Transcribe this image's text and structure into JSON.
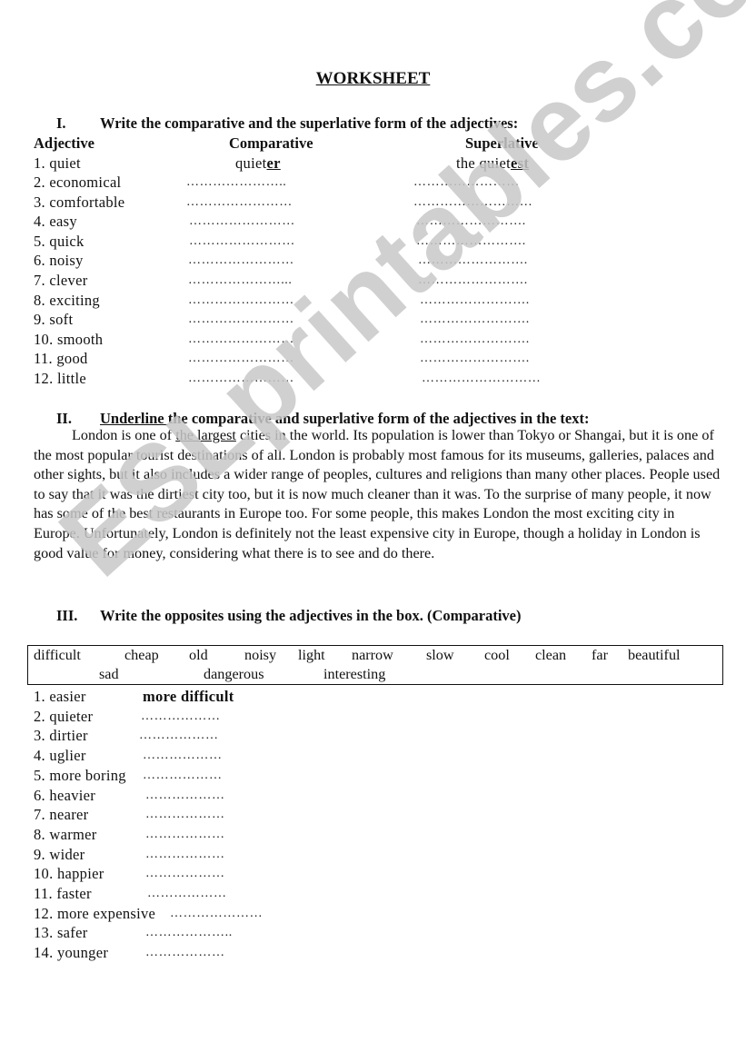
{
  "title": "WORKSHEET",
  "watermark": "ESLprintables.com",
  "section1": {
    "numeral": "I.",
    "instruction": "Write the comparative and the superlative form of the adjectives:",
    "headers": {
      "adjective": "Adjective",
      "comparative": "Comparative",
      "superlative": "Superlative"
    },
    "example": {
      "adjective": "1. quiet",
      "comparative_stem": "quiet",
      "comparative_suffix": "er",
      "superlative_stem": "the quiet",
      "superlative_suffix": "est"
    },
    "rows": [
      {
        "adjective": "2. economical",
        "comparative": "…………………..",
        "superlative": "……………………"
      },
      {
        "adjective": "3. comfortable",
        "comparative": "……………………",
        "superlative": "………………………"
      },
      {
        "adjective": "4. easy",
        "comparative": "……………………",
        "superlative": "……………………."
      },
      {
        "adjective": "5. quick",
        "comparative": "……………………",
        "superlative": "……………………."
      },
      {
        "adjective": "6. noisy",
        "comparative": "……………………",
        "superlative": "……………………."
      },
      {
        "adjective": "7. clever",
        "comparative": "…………………...",
        "superlative": "……………………."
      },
      {
        "adjective": "8. exciting",
        "comparative": "……………………",
        "superlative": "……………………."
      },
      {
        "adjective": "9. soft",
        "comparative": "……………………",
        "superlative": "……………………."
      },
      {
        "adjective": "10.  smooth",
        "comparative": "……………………",
        "superlative": "……………………."
      },
      {
        "adjective": "11.  good",
        "comparative": "……………………",
        "superlative": "……………………."
      },
      {
        "adjective": "12.  little",
        "comparative": "……………………",
        "superlative": "………………………"
      }
    ]
  },
  "section2": {
    "numeral": "II.",
    "instruction_underlined": "Underline ",
    "instruction_rest": "the comparative and superlative form of the adjectives in the text:",
    "text_before": "London is one of ",
    "text_example": "the largest",
    "text_after": " cities in the world. Its population is lower than Tokyo or Shangai, but it is one of the most popular tourist destinations of all. London is probably most famous for its museums, galleries, palaces and other sights, but it also includes a wider range of peoples, cultures and religions than many other places. People used to say that it was the dirtiest city too, but it is now much cleaner than it was. To the surprise of many people, it now has some of the best restaurants in Europe too. For some people, this makes London the most exciting city in Europe. Unfortunately, London is definitely not the least expensive city in Europe, though a holiday in London is good value for money, considering what there is to see and do there."
  },
  "section3": {
    "numeral": "III.",
    "instruction": "Write the opposites using the adjectives in the box. (Comparative)",
    "box_words": [
      "difficult",
      "cheap",
      "old",
      "noisy",
      "light",
      "narrow",
      "slow",
      "cool",
      "clean",
      "far",
      "beautiful",
      "sad",
      "dangerous",
      "interesting"
    ],
    "rows": [
      {
        "word": "1. easier",
        "answer": "more difficult"
      },
      {
        "word": "2. quieter",
        "answer": "………………"
      },
      {
        "word": "3. dirtier",
        "answer": "………………"
      },
      {
        "word": "4. uglier",
        "answer": "………………"
      },
      {
        "word": "5. more boring",
        "answer": "………………"
      },
      {
        "word": "6. heavier",
        "answer": "………………"
      },
      {
        "word": "7. nearer",
        "answer": "………………"
      },
      {
        "word": "8. warmer",
        "answer": "………………"
      },
      {
        "word": "9. wider",
        "answer": "………………"
      },
      {
        "word": "10.  happier",
        "answer": "………………"
      },
      {
        "word": "11.  faster",
        "answer": "………………"
      },
      {
        "word": "12. more expensive",
        "answer": "…………………"
      },
      {
        "word": "13.  safer",
        "answer": "……………….."
      },
      {
        "word": "14.  younger",
        "answer": "………………"
      }
    ]
  }
}
